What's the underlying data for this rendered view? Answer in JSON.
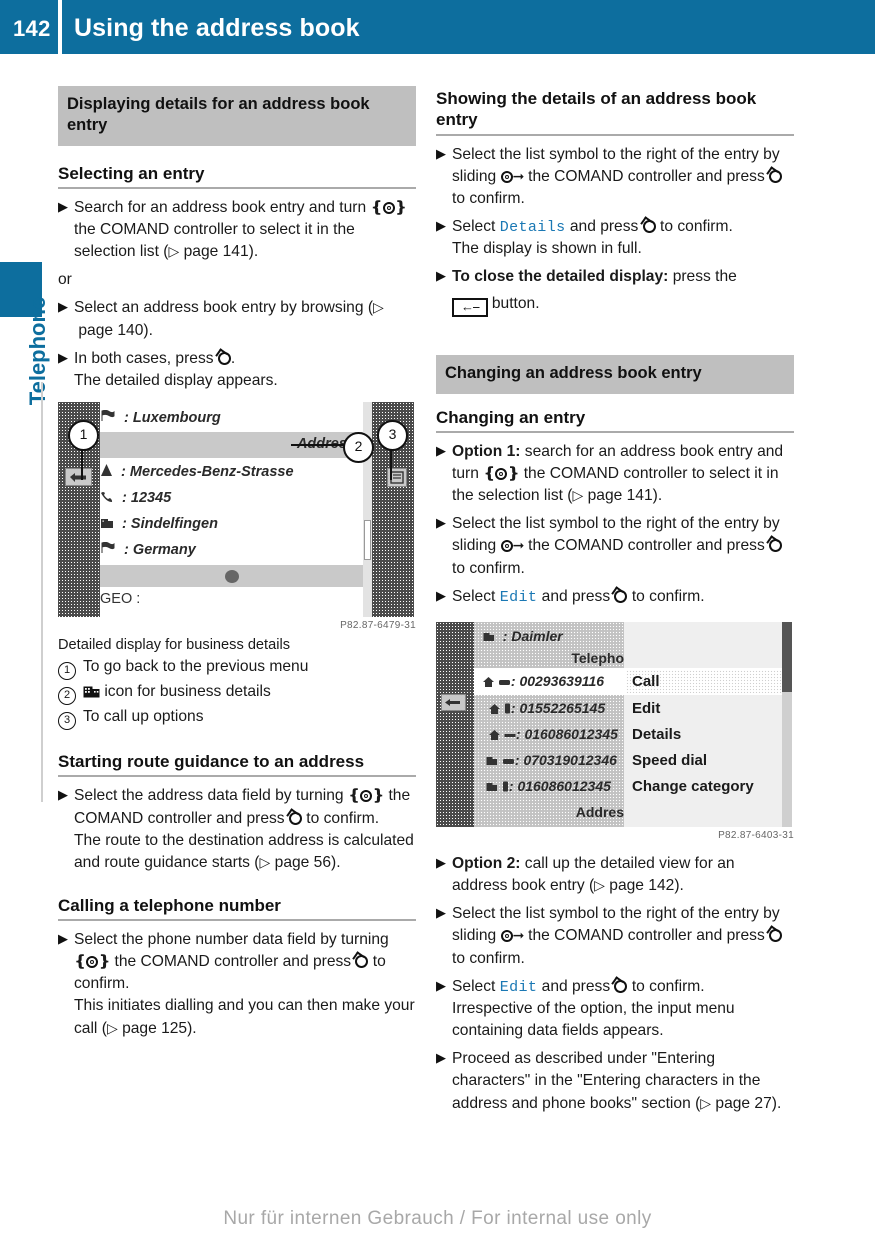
{
  "header": {
    "page_number": "142",
    "title": "Using the address book",
    "accent_color": "#0d6e9e"
  },
  "side_tab": {
    "label": "Telephone"
  },
  "left_column": {
    "section_title": "Displaying details for an address book entry",
    "subheading_1": "Selecting an entry",
    "step_1_a": "Search for an address book entry and turn",
    "step_1_b": "the COMAND controller to select it in the selection list (",
    "step_1_ref": "page 141",
    "step_1_c": ").",
    "or_label": "or",
    "step_2_a": "Select an address book entry by browsing (",
    "step_2_ref": "page 140",
    "step_2_b": ").",
    "step_3_a": "In both cases, press",
    "step_3_b": ".",
    "step_3_result": "The detailed display appears.",
    "image_code_1": "P82.87-6479-31",
    "caption": "Detailed display for business details",
    "legend": [
      {
        "num": "1",
        "text": "To go back to the previous menu"
      },
      {
        "num": "2",
        "text": "icon for business details",
        "icon": "building-icon"
      },
      {
        "num": "3",
        "text": "To call up options"
      }
    ],
    "subheading_2": "Starting route guidance to an address",
    "step_4_a": "Select the address data field by turning",
    "step_4_b": "the COMAND controller and press",
    "step_4_c": "to confirm.",
    "step_4_result_a": "The route to the destination address is calculated and route guidance starts (",
    "step_4_ref": "page 56",
    "step_4_result_b": ").",
    "subheading_3": "Calling a telephone number",
    "step_5_a": "Select the phone number data field by turning",
    "step_5_b": "the COMAND controller and press",
    "step_5_c": "to confirm.",
    "step_5_result_a": "This initiates dialling and you can then make your call (",
    "step_5_ref": "page 125",
    "step_5_result_b": ")."
  },
  "right_column": {
    "subheading_1": "Showing the details of an address book entry",
    "step_1_a": "Select the list symbol to the right of the entry by sliding",
    "step_1_b": "the COMAND controller and press",
    "step_1_c": "to confirm.",
    "step_2_a": "Select",
    "step_2_cmd": "Details",
    "step_2_b": "and press",
    "step_2_c": "to confirm.",
    "step_2_result": "The display is shown in full.",
    "step_3_bold": "To close the detailed display:",
    "step_3_a": "press the",
    "step_3_b": "button.",
    "section_title": "Changing an address book entry",
    "subheading_2": "Changing an entry",
    "step_4_bold": "Option 1:",
    "step_4_a": "search for an address book entry and turn",
    "step_4_b": "the COMAND controller to select it in the selection list (",
    "step_4_ref": "page 141",
    "step_4_c": ").",
    "step_5_a": "Select the list symbol to the right of the entry by sliding",
    "step_5_b": "the COMAND controller and press",
    "step_5_c": "to confirm.",
    "step_6_a": "Select",
    "step_6_cmd": "Edit",
    "step_6_b": "and press",
    "step_6_c": "to confirm.",
    "image_code_2": "P82.87-6403-31",
    "step_7_bold": "Option 2:",
    "step_7_a": "call up the detailed view for an address book entry (",
    "step_7_ref": "page 142",
    "step_7_b": ").",
    "step_8_a": "Select the list symbol to the right of the entry by sliding",
    "step_8_b": "the COMAND controller and press",
    "step_8_c": "to confirm.",
    "step_9_a": "Select",
    "step_9_cmd": "Edit",
    "step_9_b": "and press",
    "step_9_c": "to confirm.",
    "step_9_result": "Irrespective of the option, the input menu containing data fields appears.",
    "step_10": "Proceed as described under \"Entering characters\" in the \"Entering characters in the address and phone books\" section (",
    "step_10_ref": "page 27",
    "step_10_b": ")."
  },
  "comand_screen_1": {
    "rows": [
      {
        "label": "Luxembourg",
        "icon": "flag-icon"
      },
      {
        "label": "Mercedes-Benz-Strasse",
        "icon": "road-icon"
      },
      {
        "label": "12345",
        "icon": "phone-icon"
      },
      {
        "label": "Sindelfingen",
        "icon": "city-icon"
      },
      {
        "label": "Germany",
        "icon": "flag-icon"
      }
    ],
    "highlight_row": "Address",
    "footer_row": "GEO :",
    "callouts": [
      "1",
      "2",
      "3"
    ]
  },
  "comand_screen_2": {
    "company": "Daimler",
    "header_label": "Telepho",
    "phone_numbers": [
      "00293639116",
      "01552265145",
      "016086012345",
      "070319012346",
      "016086012345"
    ],
    "bottom_label": "Addres",
    "menu": [
      "Call",
      "Edit",
      "Details",
      "Speed dial",
      "Change category"
    ],
    "selected_menu_item": "Call"
  },
  "footer": {
    "watermark": "Nur für internen Gebrauch / For internal use only"
  }
}
